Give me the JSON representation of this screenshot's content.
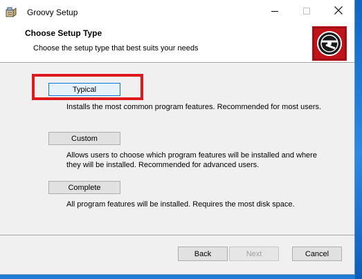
{
  "window": {
    "title": "Groovy Setup"
  },
  "banner": {
    "title": "Choose Setup Type",
    "subtitle": "Choose the setup type that best suits your needs"
  },
  "options": [
    {
      "label": "Typical",
      "description": "Installs the most common program features. Recommended for most users."
    },
    {
      "label": "Custom",
      "description": "Allows users to choose which program features will be installed and where they will be installed. Recommended for advanced users."
    },
    {
      "label": "Complete",
      "description": "All program features will be installed. Requires the most disk space."
    }
  ],
  "footer": {
    "back_label": "Back",
    "next_label": "Next",
    "cancel_label": "Cancel"
  },
  "icons": {
    "app": "installer-package-icon",
    "banner": "disc-logo-icon",
    "minimize": "minimize-icon",
    "maximize": "maximize-icon",
    "close": "close-icon"
  },
  "colors": {
    "highlight": "#e0191e",
    "banner_logo_bg": "#c0141b",
    "focus_border": "#0078d7"
  }
}
